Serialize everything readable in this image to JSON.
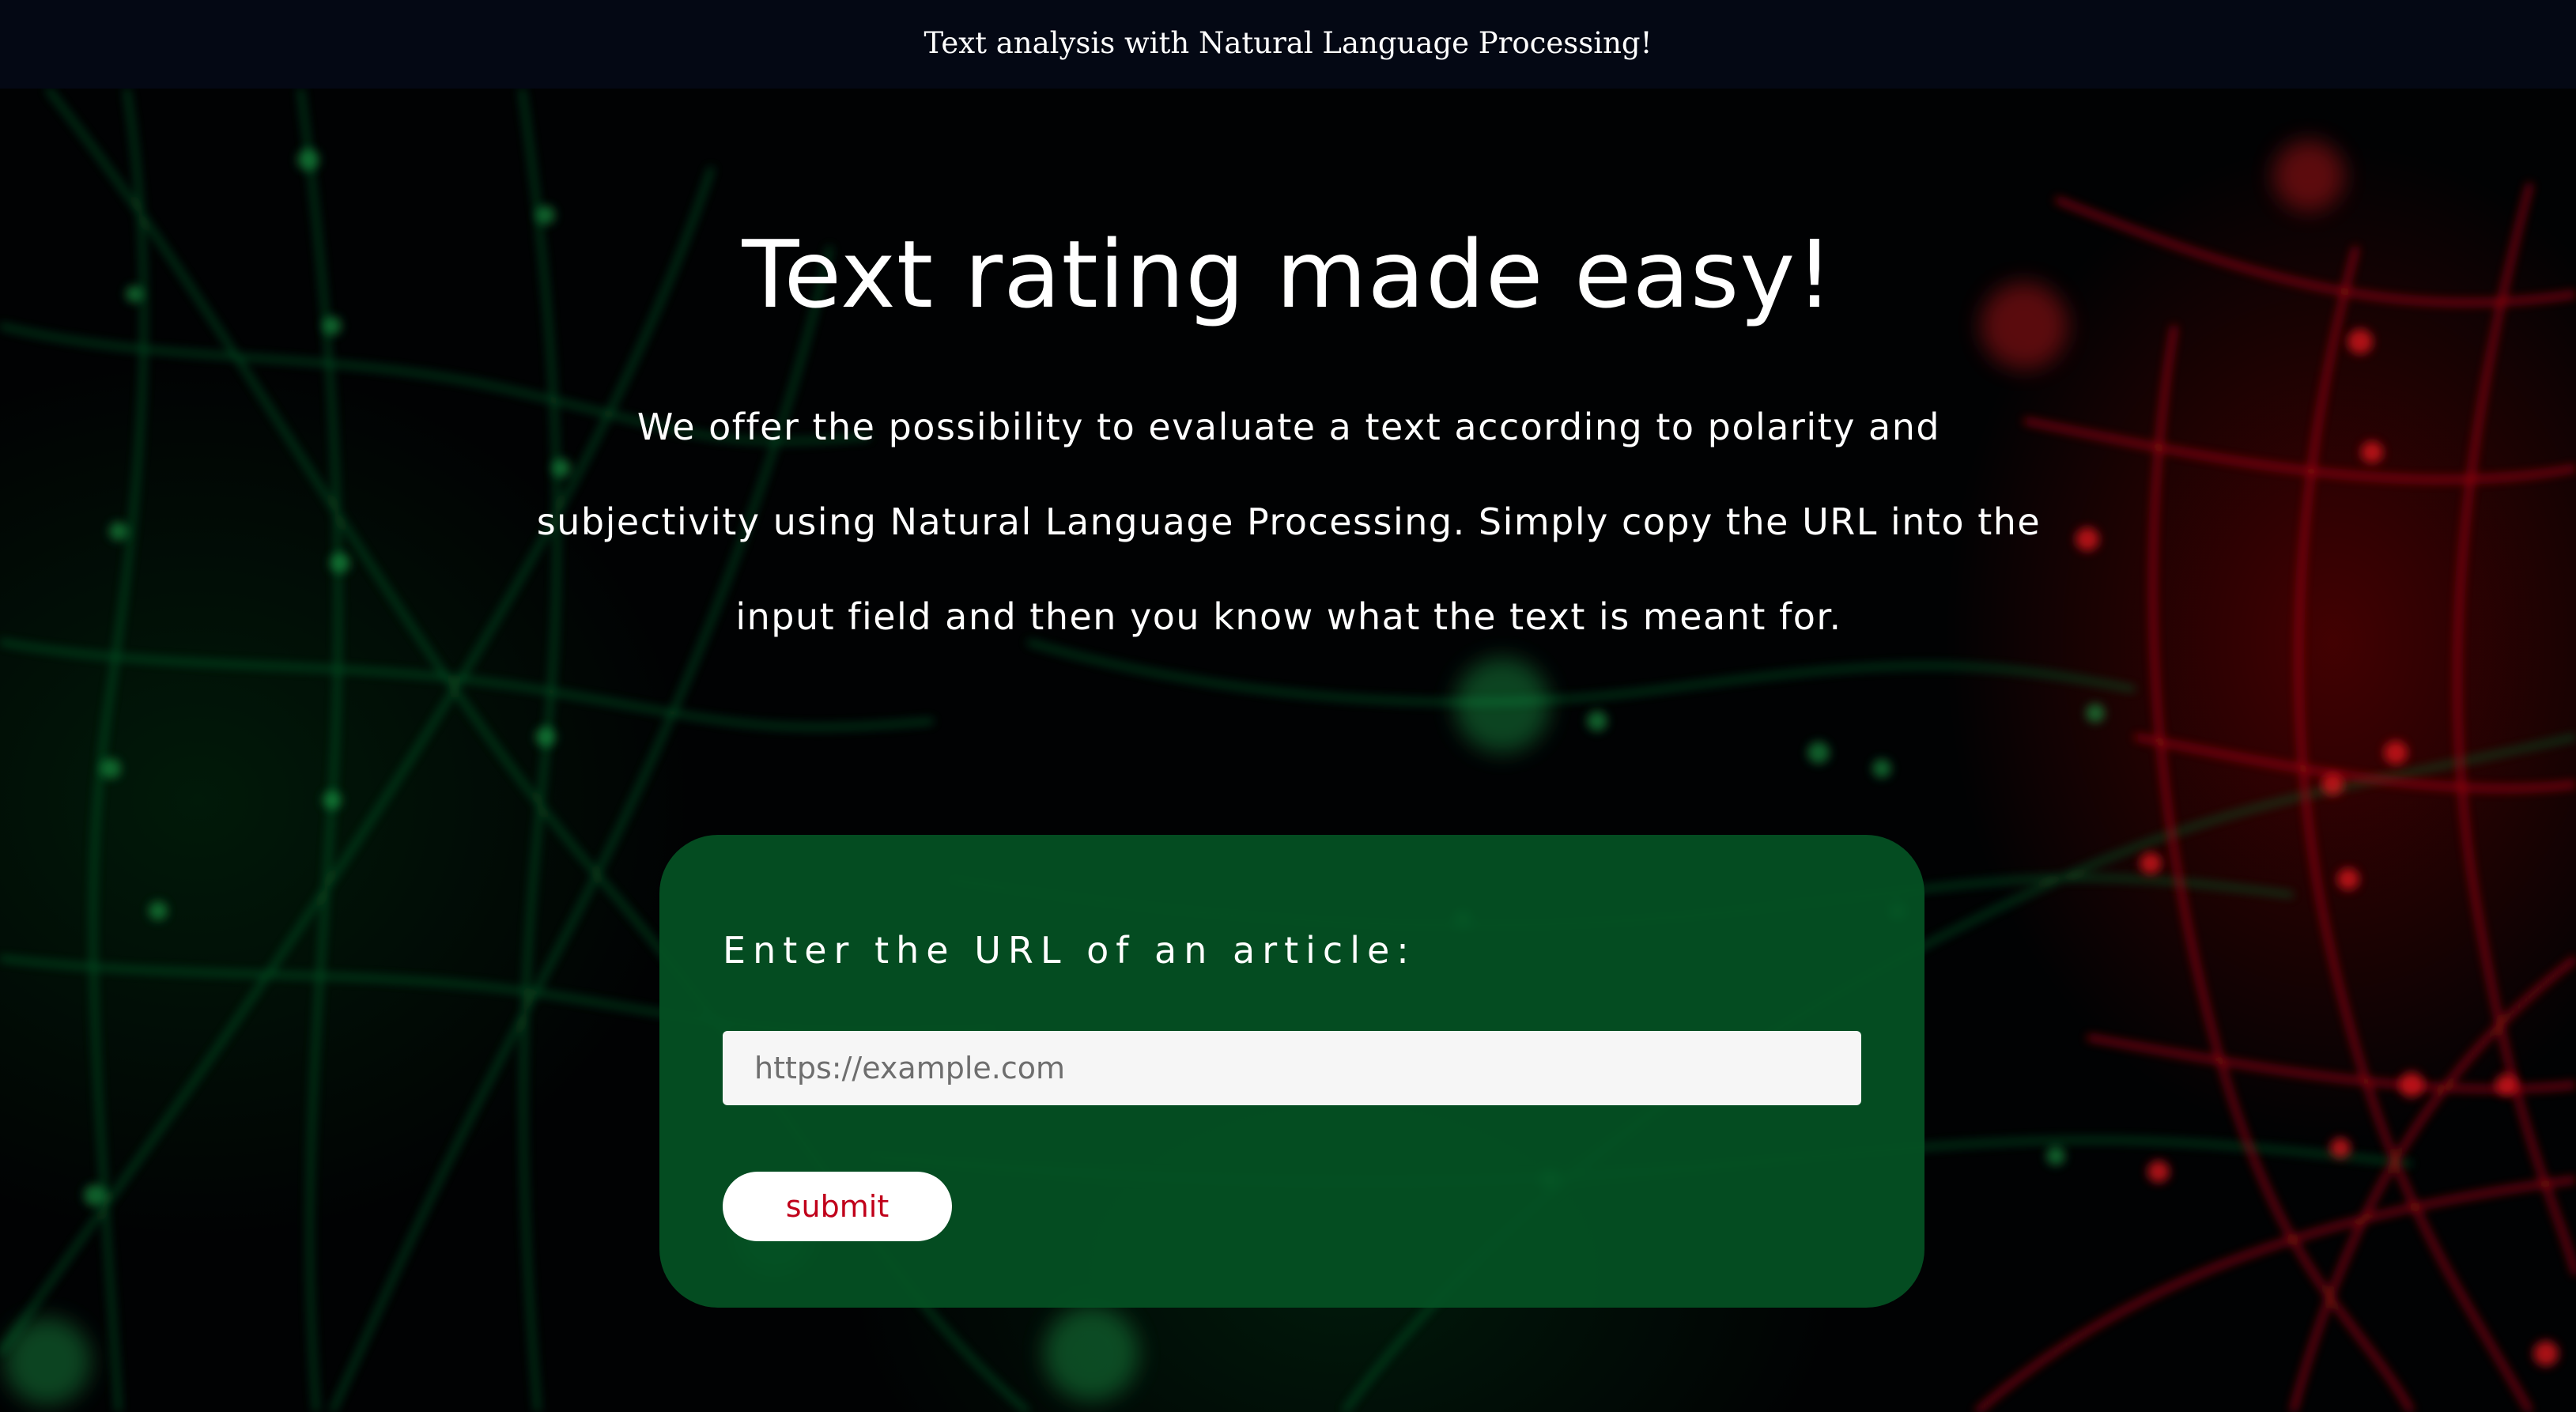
{
  "header": {
    "title": "Text analysis with Natural Language Processing!"
  },
  "hero": {
    "headline": "Text rating made easy!",
    "intro": "We offer the possibility to evaluate a text according to polarity and subjectivity using Natural Language Processing. Simply copy the URL into the input field and then you know what the text is meant for."
  },
  "form": {
    "label": "Enter the URL of an article:",
    "url_input": {
      "value": "",
      "placeholder": "https://example.com"
    },
    "submit_label": "submit"
  },
  "colors": {
    "header_bg": "#040814",
    "form_bg": "#04521f",
    "button_text": "#c0001a",
    "background_accent_green": "#0f8a3a",
    "background_accent_red": "#c8101a"
  }
}
